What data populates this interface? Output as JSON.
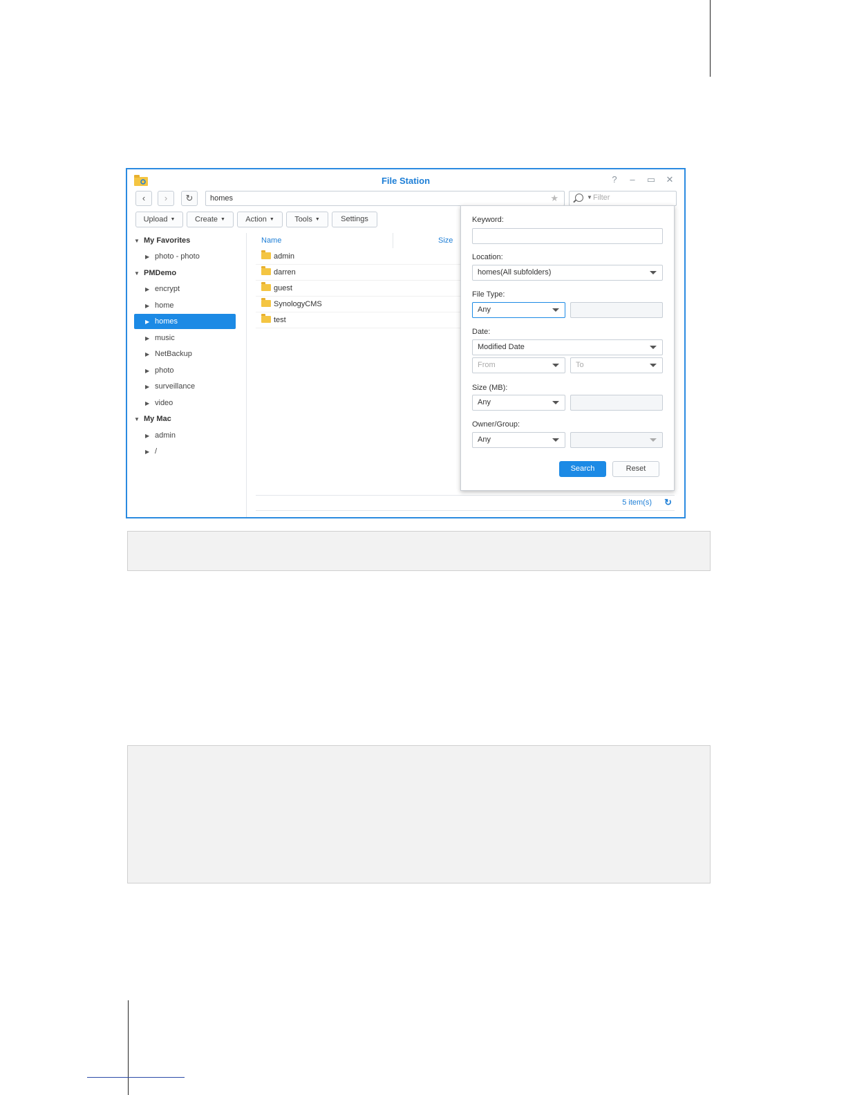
{
  "window": {
    "title": "File Station"
  },
  "nav": {
    "path": "homes",
    "filter_placeholder": "Filter"
  },
  "toolbar": {
    "upload": "Upload",
    "create": "Create",
    "action": "Action",
    "tools": "Tools",
    "settings": "Settings"
  },
  "sidebar": {
    "favorites": {
      "label": "My Favorites",
      "items": [
        "photo - photo"
      ]
    },
    "pmdemo": {
      "label": "PMDemo",
      "items": [
        "encrypt",
        "home",
        "homes",
        "music",
        "NetBackup",
        "photo",
        "surveillance",
        "video"
      ],
      "selected": "homes"
    },
    "mymac": {
      "label": "My Mac",
      "items": [
        "admin",
        "/"
      ]
    }
  },
  "list": {
    "columns": [
      "Name",
      "Size"
    ],
    "rows": [
      "admin",
      "darren",
      "guest",
      "SynologyCMS",
      "test"
    ]
  },
  "status": {
    "count": "5 item(s)"
  },
  "search": {
    "keyword_label": "Keyword:",
    "keyword_value": "",
    "location_label": "Location:",
    "location_value": "homes(All subfolders)",
    "filetype_label": "File Type:",
    "filetype_value": "Any",
    "date_label": "Date:",
    "date_value": "Modified Date",
    "from_placeholder": "From",
    "to_placeholder": "To",
    "size_label": "Size (MB):",
    "size_value": "Any",
    "owner_label": "Owner/Group:",
    "owner_value": "Any",
    "search_button": "Search",
    "reset_button": "Reset"
  },
  "colors": {
    "accent": "#1c8ae5",
    "folder": "#f4c542",
    "window_border": "#2a8ae0"
  }
}
